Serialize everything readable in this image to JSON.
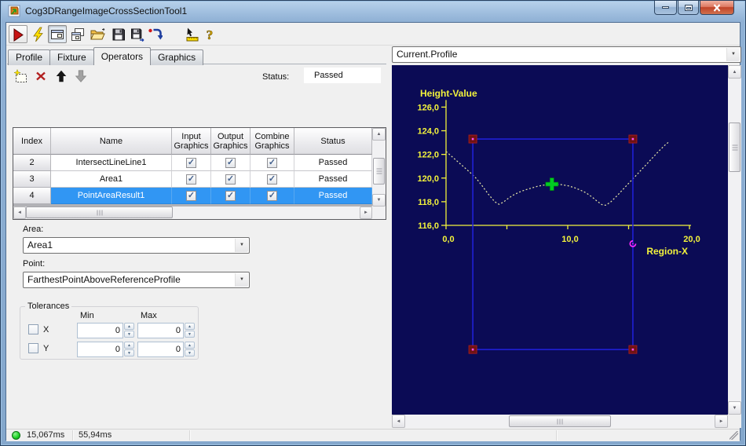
{
  "window": {
    "title": "Cog3DRangeImageCrossSectionTool1",
    "controls": [
      "minimize",
      "maximize",
      "close"
    ]
  },
  "toolbar": {
    "icons": [
      "run",
      "electric-run",
      "show-image-display",
      "copy-image-display",
      "open-file",
      "save",
      "save-as",
      "reset",
      "measure",
      "help"
    ]
  },
  "tabs": {
    "items": [
      "Profile",
      "Fixture",
      "Operators",
      "Graphics"
    ],
    "active": "Operators"
  },
  "operators": {
    "toolbar": {
      "icons": [
        "new-operator",
        "delete-operator",
        "move-up",
        "move-down"
      ],
      "status_label": "Status:",
      "status_value": "Passed"
    },
    "table": {
      "columns": [
        "Index",
        "Name",
        "Input Graphics",
        "Output Graphics",
        "Combine Graphics",
        "Status"
      ],
      "rows": [
        {
          "index": "2",
          "name": "IntersectLineLine1",
          "input": "✓",
          "output": "✓",
          "combine": "✓",
          "status": "Passed"
        },
        {
          "index": "3",
          "name": "Area1",
          "input": "✓",
          "output": "✓",
          "combine": "✓",
          "status": "Passed"
        },
        {
          "index": "4",
          "name": "PointAreaResult1",
          "input": "✓",
          "output": "✓",
          "combine": "✓",
          "status": "Passed"
        }
      ],
      "selected_row_index": "4"
    },
    "area": {
      "label": "Area:",
      "value": "Area1"
    },
    "point": {
      "label": "Point:",
      "value": "FarthestPointAboveReferenceProfile"
    },
    "tolerances": {
      "legend": "Tolerances",
      "min_header": "Min",
      "max_header": "Max",
      "rows": [
        {
          "label": "X",
          "checked": false,
          "min": "0",
          "max": "0"
        },
        {
          "label": "Y",
          "checked": false,
          "min": "0",
          "max": "0"
        }
      ]
    }
  },
  "display": {
    "selector_value": "Current.Profile"
  },
  "chart_data": {
    "type": "line",
    "title": "Current.Profile",
    "xlabel": "Region-X",
    "ylabel": "Height-Value",
    "xlim": [
      0,
      20
    ],
    "ylim": [
      116,
      126
    ],
    "background": "#0b0b55",
    "axis_color": "#f2f23c",
    "grid": false,
    "y_ticks": [
      {
        "v": 116,
        "label": "116,0"
      },
      {
        "v": 118,
        "label": "118,0"
      },
      {
        "v": 120,
        "label": "120,0"
      },
      {
        "v": 122,
        "label": "122,0"
      },
      {
        "v": 124,
        "label": "124,0"
      },
      {
        "v": 126,
        "label": "126,0"
      }
    ],
    "x_ticks": [
      {
        "v": 0,
        "label": "0,0"
      },
      {
        "v": 5,
        "label": ""
      },
      {
        "v": 10,
        "label": "10,0"
      },
      {
        "v": 15,
        "label": ""
      },
      {
        "v": 20,
        "label": "20,0"
      }
    ],
    "series": [
      {
        "name": "cross-section-profile",
        "color": "#e9e9a8",
        "style": "dotted",
        "points": [
          [
            0,
            122.25
          ],
          [
            0.5,
            121.8
          ],
          [
            1,
            121.35
          ],
          [
            1.5,
            120.9
          ],
          [
            2,
            120.45
          ],
          [
            2.5,
            119.95
          ],
          [
            3,
            119.3
          ],
          [
            3.5,
            118.6
          ],
          [
            4,
            118.0
          ],
          [
            4.35,
            117.78
          ],
          [
            4.7,
            117.95
          ],
          [
            5,
            118.2
          ],
          [
            5.5,
            118.55
          ],
          [
            6,
            118.8
          ],
          [
            6.5,
            119.0
          ],
          [
            7,
            119.15
          ],
          [
            7.5,
            119.3
          ],
          [
            8,
            119.4
          ],
          [
            8.7,
            119.48
          ],
          [
            9.4,
            119.45
          ],
          [
            10,
            119.35
          ],
          [
            10.5,
            119.2
          ],
          [
            11,
            119.0
          ],
          [
            11.5,
            118.75
          ],
          [
            12,
            118.4
          ],
          [
            12.4,
            118.05
          ],
          [
            12.8,
            117.75
          ],
          [
            13.1,
            117.7
          ],
          [
            13.5,
            117.95
          ],
          [
            14,
            118.45
          ],
          [
            14.5,
            119.0
          ],
          [
            15,
            119.55
          ],
          [
            15.5,
            120.1
          ],
          [
            16,
            120.65
          ],
          [
            16.5,
            121.2
          ],
          [
            17,
            121.75
          ],
          [
            17.5,
            122.3
          ],
          [
            18,
            122.8
          ],
          [
            18.3,
            123.05
          ]
        ]
      }
    ],
    "region_box": {
      "x1": 2.2,
      "x2": 15.35,
      "y_top": 123.3,
      "y_bottom": 105.5,
      "color": "#2121df",
      "handle_fill": "#6e1212",
      "handle_stroke": "#a31c1c",
      "handle_dot": "#ff4cff"
    },
    "markers": [
      {
        "type": "cross",
        "x": 8.7,
        "y": 119.48,
        "color": "#00cc22"
      },
      {
        "type": "spiral",
        "x": 15.35,
        "y": 114.45,
        "color": "#ff28ff"
      }
    ]
  },
  "statusbar": {
    "run_time": "15,067ms",
    "total_time": "55,94ms",
    "led_color": "#1fd428"
  }
}
